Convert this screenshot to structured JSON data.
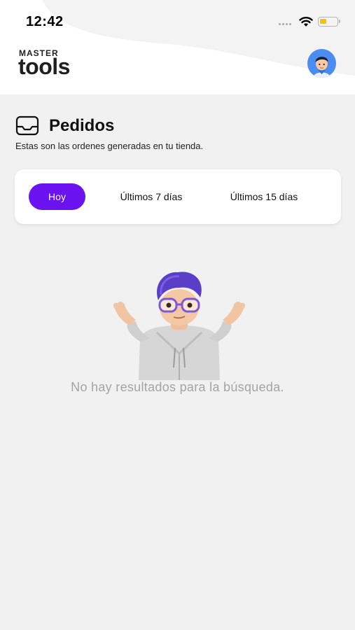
{
  "status_bar": {
    "time": "12:42"
  },
  "brand": {
    "line1": "MASTER",
    "line2": "tools"
  },
  "page": {
    "title": "Pedidos",
    "subtitle": "Estas son las ordenes generadas en tu tienda."
  },
  "filters": {
    "tabs": [
      {
        "label": "Hoy",
        "active": true
      },
      {
        "label": "Últimos 7 días",
        "active": false
      },
      {
        "label": "Últimos 15 días",
        "active": false
      }
    ]
  },
  "empty_state": {
    "message": "No hay resultados para la búsqueda."
  },
  "colors": {
    "accent": "#6a12f0",
    "background": "#f1f1f1",
    "header_bg": "#ffffff",
    "avatar_bg": "#4b8cf0",
    "battery": "#f5c400",
    "muted_text": "#a4a4a4"
  },
  "icons": {
    "wifi": "wifi-icon",
    "battery": "battery-icon",
    "signal": "signal-dots-icon",
    "profile": "avatar-icon",
    "orders": "inbox-tray-icon",
    "empty_state": "shrugging-memoji-icon"
  }
}
